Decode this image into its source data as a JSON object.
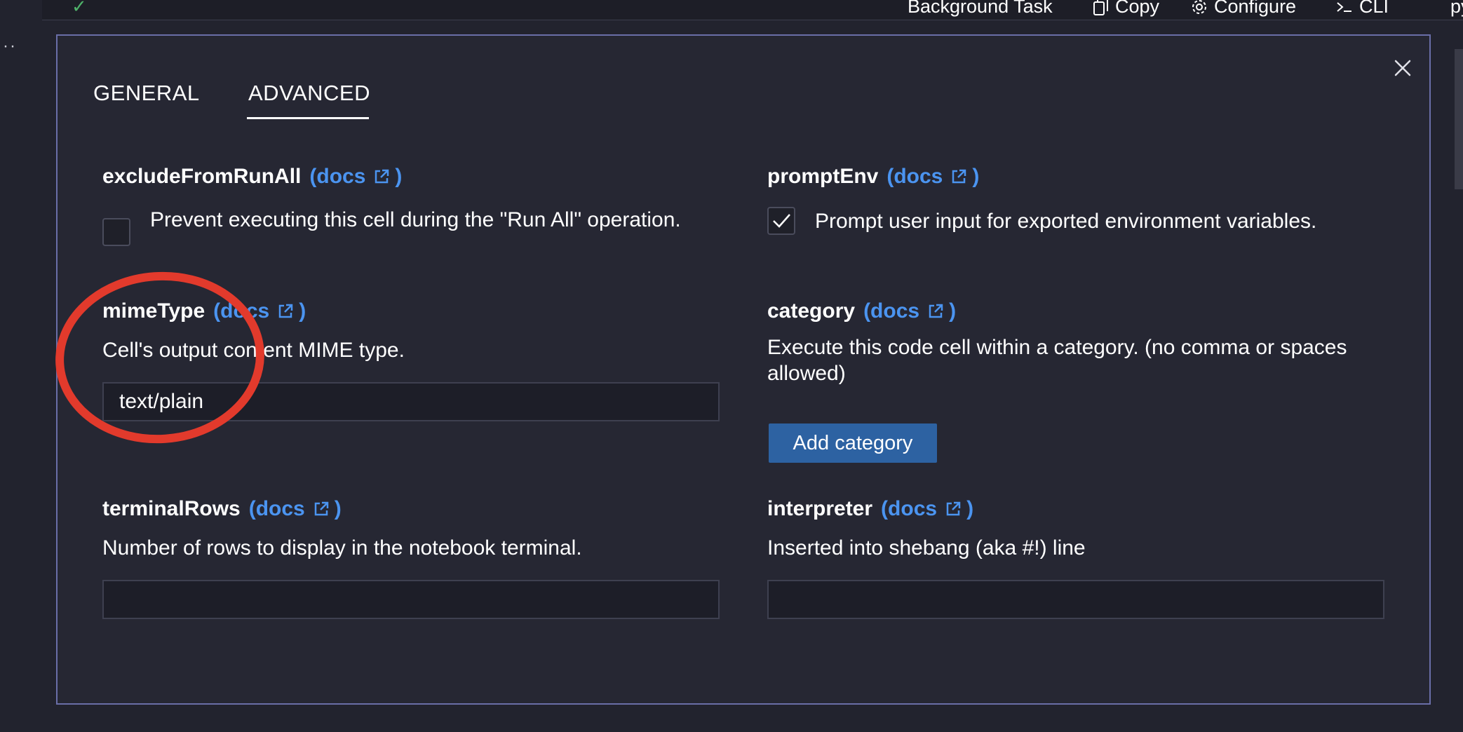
{
  "toolbar": {
    "background_task_label": "Background Task",
    "copy_label": "Copy",
    "configure_label": "Configure",
    "cli_label": "CLI",
    "language_label": "py"
  },
  "dialog": {
    "tabs": [
      {
        "label": "GENERAL",
        "selected": false
      },
      {
        "label": "ADVANCED",
        "selected": true
      }
    ],
    "docs_label": "(docs",
    "docs_close": ")",
    "fields": {
      "excludeFromRunAll": {
        "label": "excludeFromRunAll",
        "description": "Prevent executing this cell during the \"Run All\" operation.",
        "checked": false
      },
      "promptEnv": {
        "label": "promptEnv",
        "description": "Prompt user input for exported environment variables.",
        "checked": true
      },
      "mimeType": {
        "label": "mimeType",
        "description": "Cell's output content MIME type.",
        "value": "text/plain"
      },
      "category": {
        "label": "category",
        "description": "Execute this code cell within a category. (no comma or spaces allowed)",
        "button_label": "Add category"
      },
      "terminalRows": {
        "label": "terminalRows",
        "description": "Number of rows to display in the notebook terminal.",
        "value": ""
      },
      "interpreter": {
        "label": "interpreter",
        "description": "Inserted into shebang (aka #!) line",
        "value": ""
      }
    }
  },
  "colors": {
    "background": "#22232e",
    "modal_border": "#6a6ea8",
    "link": "#4b94f0",
    "primary_button": "#2d62a2",
    "annotation": "#e23a2c",
    "success_check": "#4fb36a"
  }
}
